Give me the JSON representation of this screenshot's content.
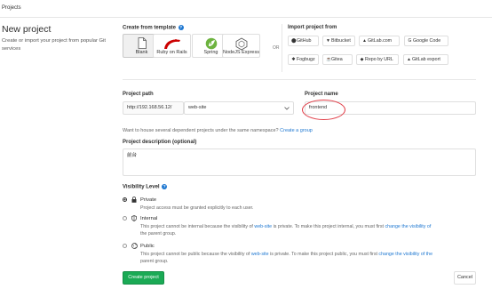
{
  "topbar": {
    "title": "Projects"
  },
  "header": {
    "title": "New project",
    "description": "Create or import your project from popular Git services"
  },
  "template": {
    "heading": "Create from template",
    "help": "?",
    "items": [
      {
        "label": "Blank",
        "icon": "blank-page-icon"
      },
      {
        "label": "Ruby on Rails",
        "icon": "rails-icon"
      },
      {
        "label": "Spring",
        "icon": "spring-icon"
      },
      {
        "label": "NodeJS Express",
        "icon": "node-icon"
      }
    ],
    "or": "OR"
  },
  "import": {
    "heading": "Import project from",
    "items": [
      {
        "label": "GitHub",
        "icon": "github-icon"
      },
      {
        "label": "Bitbucket",
        "icon": "bitbucket-icon"
      },
      {
        "label": "GitLab.com",
        "icon": "gitlab-icon"
      },
      {
        "label": "Google Code",
        "icon": "google-icon"
      },
      {
        "label": "Fogbugz",
        "icon": "bug-icon"
      },
      {
        "label": "Gitea",
        "icon": "gitea-icon"
      },
      {
        "label": "Repo by URL",
        "icon": "git-icon"
      },
      {
        "label": "GitLab export",
        "icon": "gitlab-icon"
      }
    ]
  },
  "path": {
    "label": "Project path",
    "prefix": "http://192.168.56.12/",
    "namespace": "web-site"
  },
  "name": {
    "label": "Project name",
    "value": "frontend"
  },
  "namespace_hint": {
    "text": "Want to house several dependent projects under the same namespace?",
    "link": "Create a group"
  },
  "description": {
    "label": "Project description (optional)",
    "value": "前台"
  },
  "visibility": {
    "label": "Visibility Level",
    "help": "?",
    "options": [
      {
        "title": "Private",
        "icon": "lock-icon",
        "selected": true,
        "line1": "Project access must be granted explicitly to each user.",
        "line2": ""
      },
      {
        "title": "Internal",
        "icon": "shield-icon",
        "selected": false,
        "line1a": "This project cannot be internal because the visibility of ",
        "line1b": "web-site",
        "line1c": " is private. To make this project internal, you must first ",
        "line1d": "change the visibility of",
        "line2": "the parent group."
      },
      {
        "title": "Public",
        "icon": "globe-icon",
        "selected": false,
        "line1a": "This project cannot be public because the visibility of ",
        "line1b": "web-site",
        "line1c": " is private. To make this project public, you must first ",
        "line1d": "change the visibility of the",
        "line2": "parent group."
      }
    ]
  },
  "actions": {
    "create": "Create project",
    "cancel": "Cancel"
  },
  "colors": {
    "accent": "#1aaa55",
    "link": "#1f78d1",
    "annotation": "#e2404a"
  }
}
